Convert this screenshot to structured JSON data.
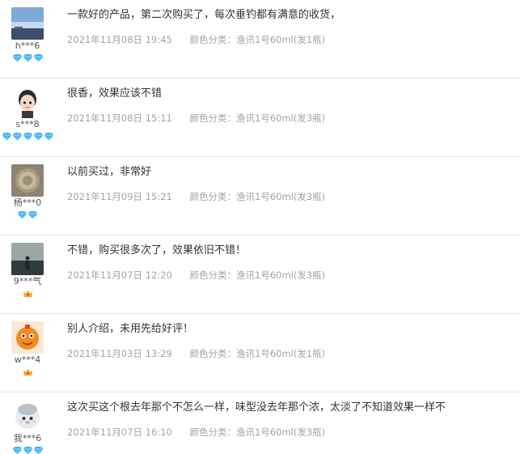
{
  "reviews": [
    {
      "username": "h***6",
      "avatar": "lake-landscape",
      "badge_type": "diamond",
      "badge_count": 3,
      "comment": "一款好的产品，第二次购买了，每次垂钓都有满意的收货，",
      "date": "2021年11月08日 19:45",
      "spec": "颜色分类：渔讯1号60ml(发1瓶)"
    },
    {
      "username": "s***8",
      "avatar": "cartoon-boy",
      "badge_type": "diamond",
      "badge_count": 5,
      "comment": "很香，效果应该不错",
      "date": "2021年11月08日 15:11",
      "spec": "颜色分类：渔讯1号60ml(发3瓶)"
    },
    {
      "username": "杨***0",
      "avatar": "old-coin",
      "badge_type": "diamond",
      "badge_count": 2,
      "comment": "以前买过，非常好",
      "date": "2021年11月09日 15:21",
      "spec": "颜色分类：渔讯1号60ml(发3瓶)"
    },
    {
      "username": "9***气",
      "avatar": "person-sunset",
      "badge_type": "crown",
      "badge_count": 1,
      "comment": "不错，购买很多次了，效果依旧不错！",
      "date": "2021年11月07日 12:20",
      "spec": "颜色分类：渔讯1号60ml(发3瓶)"
    },
    {
      "username": "w***4",
      "avatar": "orange-mascot",
      "badge_type": "crown",
      "badge_count": 1,
      "comment": "别人介绍，未用先给好评！",
      "date": "2021年11月03日 13:29",
      "spec": "颜色分类：渔讯1号60ml(发1瓶)"
    },
    {
      "username": "我***6",
      "avatar": "default-avatar",
      "badge_type": "diamond",
      "badge_count": 3,
      "comment": "这次买这个根去年那个不怎么一样，味型没去年那个浓，太淡了不知道效果一样不",
      "date": "2021年11月07日 16:10",
      "spec": "颜色分类：渔讯1号60ml(发3瓶)"
    }
  ],
  "colors": {
    "diamond": "#3ab0f0",
    "crown": "#f5a623",
    "meta_text": "#a3a3a3",
    "divider": "#e6e6e6"
  }
}
